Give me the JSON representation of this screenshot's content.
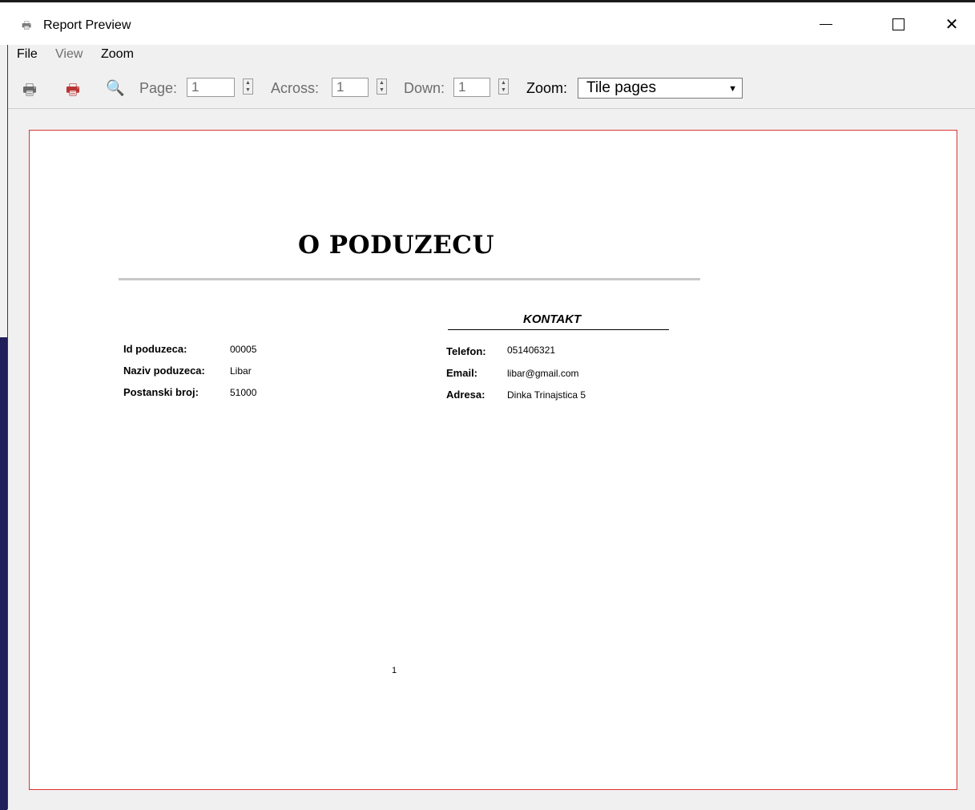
{
  "window": {
    "title": "Report Preview",
    "app_icon": "printer-icon",
    "controls": [
      "minimize",
      "maximize",
      "close"
    ]
  },
  "menu": {
    "items": [
      {
        "label": "File",
        "enabled": true
      },
      {
        "label": "View",
        "enabled": false
      },
      {
        "label": "Zoom",
        "enabled": true
      }
    ]
  },
  "toolbar": {
    "icons": [
      "print-icon",
      "close-preview-icon",
      "search-icon"
    ],
    "page_label": "Page:",
    "page_value": "1",
    "across_label": "Across:",
    "across_value": "1",
    "down_label": "Down:",
    "down_value": "1",
    "zoom_label": "Zoom:",
    "zoom_value": "Tile pages"
  },
  "report": {
    "title": "O PODUZECU",
    "kontakt_heading": "KONTAKT",
    "company": [
      {
        "label": "Id poduzeca:",
        "value": "00005"
      },
      {
        "label": "Naziv poduzeca:",
        "value": "Libar"
      },
      {
        "label": "Postanski broj:",
        "value": "51000"
      }
    ],
    "contact": [
      {
        "label": "Telefon:",
        "value": "051406321"
      },
      {
        "label": "Email:",
        "value": "libar@gmail.com"
      },
      {
        "label": "Adresa:",
        "value": "Dinka Trinajstica 5"
      }
    ],
    "page_number": "1"
  }
}
